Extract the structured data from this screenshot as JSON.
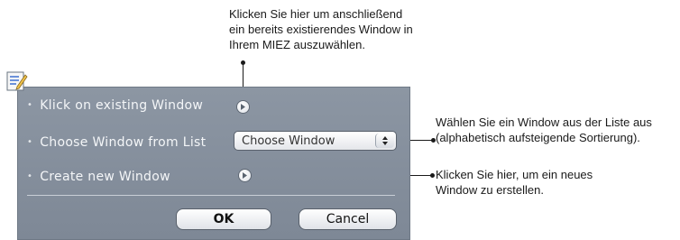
{
  "callouts": {
    "top": [
      "Klicken Sie hier um anschließend",
      "ein bereits existierendes Window in",
      "Ihrem MIEZ auszuwählen."
    ],
    "right_list": [
      "Wählen Sie ein Window aus der Liste aus",
      "(alphabetisch aufsteigende Sortierung)."
    ],
    "right_new": [
      "Klicken Sie hier, um ein neues",
      "Window zu erstellen."
    ]
  },
  "dialog": {
    "options": {
      "existing": "Klick on existing Window",
      "list": "Choose Window from List",
      "new": "Create new Window"
    },
    "bullet": "•",
    "select": {
      "value": "Choose Window"
    },
    "buttons": {
      "ok": "OK",
      "cancel": "Cancel"
    }
  },
  "icons": {
    "notepad": "notepad-edit-icon",
    "arrow": "arrow-right-circle-icon",
    "stepper": "up-down-stepper-icon"
  }
}
